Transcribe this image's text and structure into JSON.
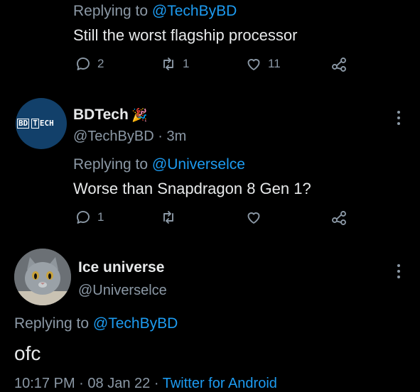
{
  "tweet1": {
    "replying_prefix": "Replying to",
    "replying_handle": "@TechByBD",
    "text": "Still the worst flagship processor",
    "replies": "2",
    "retweets": "1",
    "likes": "11"
  },
  "tweet2": {
    "avatar_text_1": "BD",
    "avatar_text_2": "T",
    "avatar_text_3": "ECH",
    "name": "BDTech",
    "name_emoji": "🎉",
    "handle": "@TechByBD",
    "separator": "·",
    "time": "3m",
    "replying_prefix": "Replying to",
    "replying_handle": "@Universelce",
    "text": "Worse than Snapdragon 8 Gen 1?",
    "replies": "1"
  },
  "tweet3": {
    "name": "Ice universe",
    "handle": "@Universelce",
    "replying_prefix": "Replying to",
    "replying_handle": "@TechByBD",
    "text": "ofc",
    "time": "10:17 PM",
    "sep1": "·",
    "date": "08 Jan 22",
    "sep2": "·",
    "source": "Twitter for Android"
  },
  "colors": {
    "background": "#000000",
    "text": "#e7e9ea",
    "muted": "#8b98a5",
    "link": "#1d9bf0",
    "bdtech_avatar": "#12406a"
  }
}
